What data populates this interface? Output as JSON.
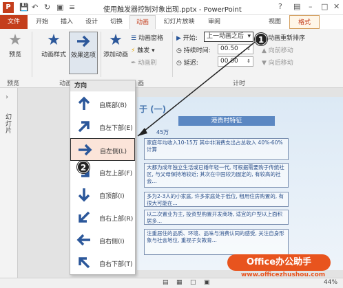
{
  "titlebar": {
    "app_letter": "P",
    "title": "使用触发器控制对象出现.pptx - PowerPoint",
    "help": "?"
  },
  "tabs": [
    "文件",
    "开始",
    "插入",
    "设计",
    "切换",
    "动画",
    "幻灯片放映",
    "审阅",
    "视图",
    "格式"
  ],
  "ribbon": {
    "preview": "预览",
    "animation_style": "动画样式",
    "effect_options": "效果选项",
    "add_animation": "添加动画",
    "animation_pane": "动画窗格",
    "trigger": "触发",
    "animation_painter": "动画刷",
    "start_label": "开始:",
    "start_value": "上一动画之后",
    "duration_label": "持续时间:",
    "duration_value": "00.50",
    "delay_label": "延迟:",
    "delay_value": "00.00",
    "reorder": "对动画重新排序",
    "move_earlier": "向前移动",
    "move_later": "向后移动",
    "group_preview": "预览",
    "group_animation": "动画",
    "group_advanced": "画",
    "group_timing": "计时"
  },
  "menu": {
    "header": "方向",
    "items": [
      "自底部(B)",
      "自左下部(E)",
      "自左侧(L)",
      "自左上部(F)",
      "自顶部(I)",
      "自右上部(R)",
      "自右侧(I)",
      "自右下部(T)"
    ],
    "selected_index": 2
  },
  "leftpane": {
    "label": "幻灯片"
  },
  "slide": {
    "title": "于 (一)",
    "heading": "港贵村特征",
    "box_label": "45万",
    "boxes": [
      "家庭年均收入10-15万 其中非消费支出占总收入 40%-60%计算",
      "大都为成年独立生活或已婚年轻一代, 可根据需要购于传统社区, 与父母保持地较近; 其次在中国较为固定的, 有较高的社会...",
      "多为2-3人的小家庭, 许多家庭处于低位, 租用住房购置的, 有很大可能在...",
      "以二次置业为主, 投资型购置开发商场, 适宜的户型以上面积居多...",
      "注重居住的品质、环境、品味与消费认同的感受, 关注自身形象与社会地位, 重视子女教育..."
    ]
  },
  "callouts": [
    "1",
    "2"
  ],
  "status": {
    "zoom": "44%"
  },
  "watermark": {
    "brand": "Office办公助手",
    "url": "www.officezhushou.com"
  },
  "colors": {
    "accent": "#c43e1c",
    "ribbon_blue": "#2b579a",
    "watermark": "#e8541e"
  }
}
